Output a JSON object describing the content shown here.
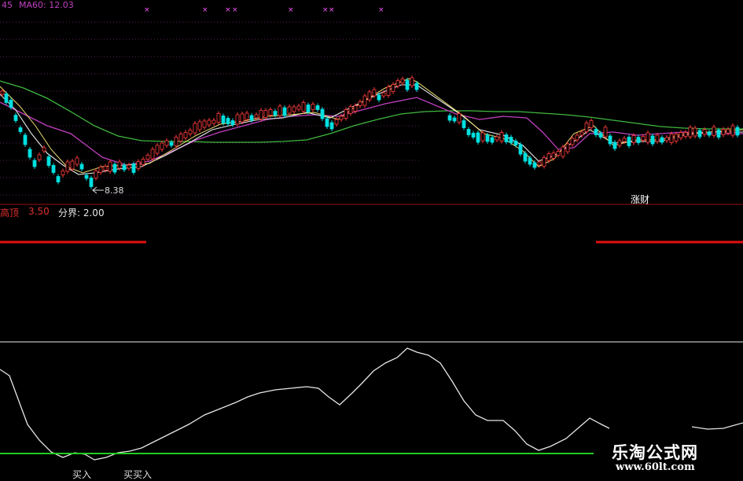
{
  "top_bar": {
    "ma_prev_suffix": "45",
    "ma60_label": "MA60: 12.03",
    "markers": [
      "×",
      "×",
      "×",
      "×",
      "×",
      "×",
      "×",
      "×",
      "×"
    ]
  },
  "price_panel": {
    "low_annotation": "8.38",
    "right_label": "涨财"
  },
  "indicator_bar": {
    "label1_name": "高顶",
    "label1_value": "3.50",
    "label2": "分界: 2.00"
  },
  "bottom_panel": {
    "buy_label_1": "买入",
    "buy_label_2": "买买入"
  },
  "watermark": {
    "title": "乐淘公式网",
    "url": "www.60lt.com"
  },
  "colors": {
    "background": "#000000",
    "up_candle": "#ff3b3b",
    "down_candle": "#00e0e0",
    "ma60": "#3fb83f",
    "ma_purple": "#c040c0",
    "ma_white": "#e8e8e8",
    "red_line": "#e01010",
    "green_line": "#22cc22",
    "osc_line": "#e6e6e6",
    "marker": "#ff55ff"
  },
  "icons": {
    "low_arrow": "arrow-left-icon"
  }
}
